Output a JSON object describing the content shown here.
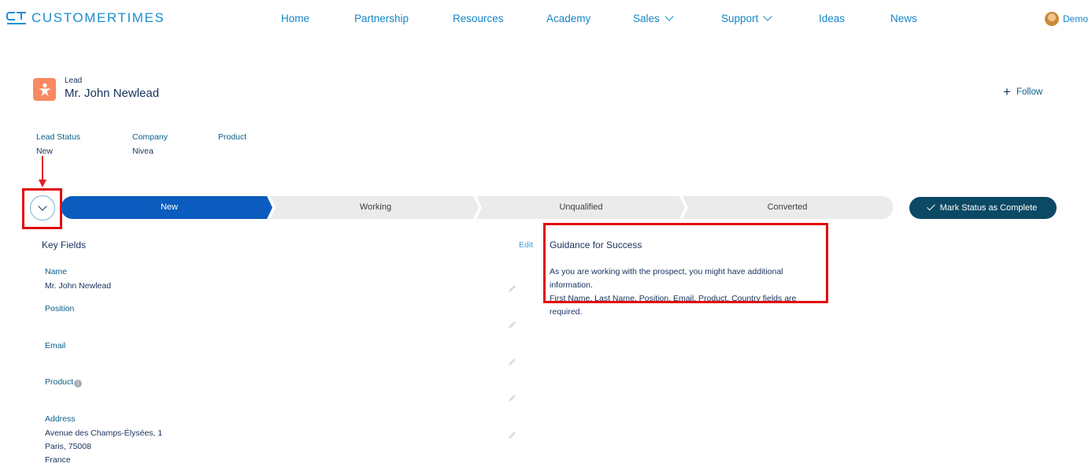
{
  "brand": {
    "name": "CUSTOMERTIMES",
    "accent": "#1a8fd0"
  },
  "nav": [
    {
      "label": "Home",
      "dropdown": false
    },
    {
      "label": "Partnership",
      "dropdown": false
    },
    {
      "label": "Resources",
      "dropdown": false
    },
    {
      "label": "Academy",
      "dropdown": false
    },
    {
      "label": "Sales",
      "dropdown": true
    },
    {
      "label": "Support",
      "dropdown": true
    },
    {
      "label": "Ideas",
      "dropdown": false
    },
    {
      "label": "News",
      "dropdown": false
    }
  ],
  "user": {
    "name": "Demo",
    "icon": "user-avatar"
  },
  "record": {
    "type": "Lead",
    "title": "Mr. John Newlead",
    "icon": "lead-icon",
    "icon_color": "#f88962",
    "follow_label": "Follow"
  },
  "highlights": [
    {
      "label": "Lead Status",
      "value": "New"
    },
    {
      "label": "Company",
      "value": "Nivea"
    },
    {
      "label": "Product",
      "value": ""
    }
  ],
  "path": {
    "stages": [
      "New",
      "Working",
      "Unqualified",
      "Converted"
    ],
    "current": 0,
    "active_color": "#0b5cbe",
    "inactive_color": "#ebebeb",
    "button_label": "Mark Status as Complete",
    "button_color": "#0b4964"
  },
  "key_fields": {
    "title": "Key Fields",
    "edit_label": "Edit",
    "fields": [
      {
        "label": "Name",
        "value": "Mr. John Newlead"
      },
      {
        "label": "Position",
        "value": ""
      },
      {
        "label": "Email",
        "value": ""
      },
      {
        "label": "Product",
        "value": "",
        "info": true
      },
      {
        "label": "Address",
        "lines": [
          "Avenue des Champs-Élysées, 1",
          "Paris, 75008",
          "France"
        ]
      }
    ]
  },
  "guidance": {
    "title": "Guidance for Success",
    "lines": [
      "As you are working with the prospect, you might have additional information.",
      "First Name, Last Name, Position, Email, Product, Country fields are required."
    ]
  },
  "annotation_color": "#e20a0a"
}
